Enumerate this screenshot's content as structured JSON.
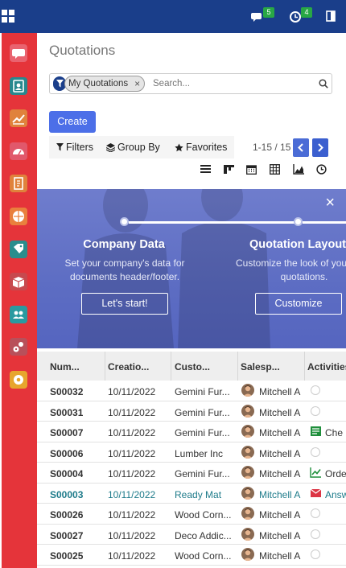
{
  "topbar": {
    "messages_count": "5",
    "activities_count": "4",
    "brand_color": "#1a3e8a"
  },
  "sidebar": {
    "color": "#e5343a",
    "items": [
      {
        "name": "discuss",
        "color": "#e9636f"
      },
      {
        "name": "contacts",
        "color": "#27888e"
      },
      {
        "name": "crm",
        "color": "#e0823c"
      },
      {
        "name": "dashboards",
        "color": "#e1586b"
      },
      {
        "name": "invoicing",
        "color": "#e0823c"
      },
      {
        "name": "website",
        "color": "#e9803d"
      },
      {
        "name": "sales",
        "color": "#2a8d8d"
      },
      {
        "name": "inventory",
        "color": "#c7494e"
      },
      {
        "name": "employees",
        "color": "#2a9aa0"
      },
      {
        "name": "manufacturing",
        "color": "#b8505a"
      },
      {
        "name": "settings",
        "color": "#e7a52d"
      }
    ]
  },
  "page": {
    "title": "Quotations"
  },
  "search": {
    "facet_label": "My Quotations",
    "facet_remove": "×",
    "placeholder": "Search..."
  },
  "toolbar": {
    "create_label": "Create",
    "filters_label": "Filters",
    "groupby_label": "Group By",
    "favorites_label": "Favorites",
    "pager_text": "1-15 / 15"
  },
  "banner": {
    "close": "×",
    "steps": [
      {
        "title": "Company Data",
        "desc_line1": "Set your company's data for",
        "desc_line2": "documents header/footer.",
        "button": "Let's start!"
      },
      {
        "title": "Quotation Layout",
        "desc_line1": "Customize the look of your",
        "desc_line2": "quotations.",
        "button": "Customize"
      }
    ]
  },
  "table": {
    "columns": [
      "Num...",
      "Creatio...",
      "Custo...",
      "Salesp...",
      "Activities"
    ],
    "rows": [
      {
        "number": "S00032",
        "date": "10/11/2022",
        "customer": "Gemini Fur...",
        "salesperson": "Mitchell A",
        "activity": "clock",
        "activity_text": ""
      },
      {
        "number": "S00031",
        "date": "10/11/2022",
        "customer": "Gemini Fur...",
        "salesperson": "Mitchell A",
        "activity": "clock",
        "activity_text": ""
      },
      {
        "number": "S00007",
        "date": "10/11/2022",
        "customer": "Gemini Fur...",
        "salesperson": "Mitchell A",
        "activity": "task",
        "activity_text": "Che"
      },
      {
        "number": "S00006",
        "date": "10/11/2022",
        "customer": "Lumber Inc",
        "salesperson": "Mitchell A",
        "activity": "clock",
        "activity_text": ""
      },
      {
        "number": "S00004",
        "date": "10/11/2022",
        "customer": "Gemini Fur...",
        "salesperson": "Mitchell A",
        "activity": "chart",
        "activity_text": "Orde"
      },
      {
        "number": "S00003",
        "date": "10/11/2022",
        "customer": "Ready Mat",
        "salesperson": "Mitchell A",
        "activity": "mail",
        "activity_text": "Answ",
        "highlight": true
      },
      {
        "number": "S00026",
        "date": "10/11/2022",
        "customer": "Wood Corn...",
        "salesperson": "Mitchell A",
        "activity": "clock",
        "activity_text": ""
      },
      {
        "number": "S00027",
        "date": "10/11/2022",
        "customer": "Deco Addic...",
        "salesperson": "Mitchell A",
        "activity": "clock",
        "activity_text": ""
      },
      {
        "number": "S00025",
        "date": "10/11/2022",
        "customer": "Wood Corn...",
        "salesperson": "Mitchell A",
        "activity": "clock",
        "activity_text": ""
      }
    ]
  }
}
